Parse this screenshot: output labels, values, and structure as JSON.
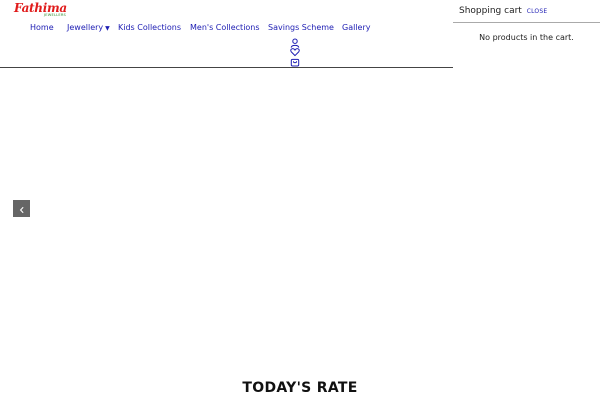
{
  "brand": {
    "name": "Fathima",
    "tagline": "JEWELLERS",
    "name_color": "#e01b1b",
    "tagline_color": "#2c8c2c"
  },
  "nav": {
    "items": [
      {
        "label": "Home"
      },
      {
        "label": "Jewellery",
        "has_dropdown": true
      },
      {
        "label": "Kids Collections"
      },
      {
        "label": "Men's Collections"
      },
      {
        "label": "Savings Scheme"
      },
      {
        "label": "Gallery"
      }
    ],
    "link_color": "#1d1db3"
  },
  "header_icons": [
    "user-icon",
    "heart-icon",
    "shopping-bag-icon"
  ],
  "cart": {
    "title": "Shopping cart",
    "close_label": "CLOSE",
    "empty_message": "No products in the cart."
  },
  "slider": {
    "prev_icon": "chevron-left-icon"
  },
  "sections": {
    "todays_rate_title": "TODAY'S RATE"
  }
}
